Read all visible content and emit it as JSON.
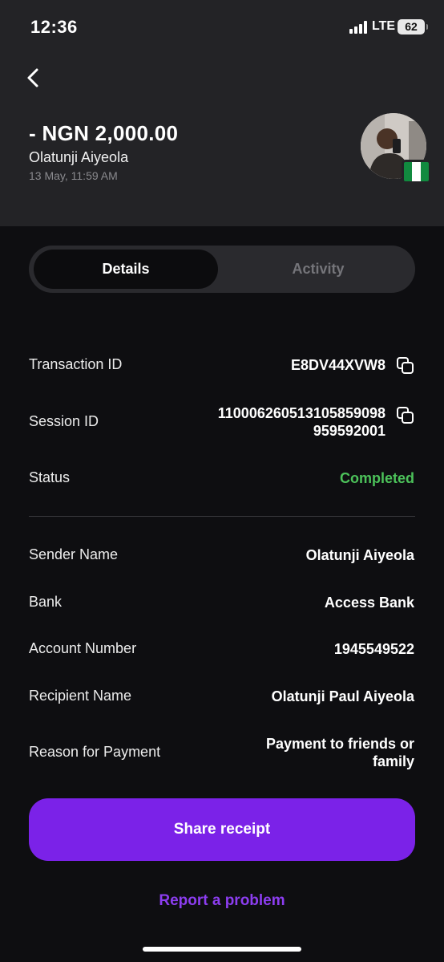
{
  "status_bar": {
    "time": "12:36",
    "network": "LTE",
    "battery": "62"
  },
  "transaction": {
    "amount": "- NGN 2,000.00",
    "name": "Olatunji Aiyeola",
    "datetime": "13 May, 11:59 AM"
  },
  "tabs": [
    {
      "label": "Details",
      "active": true
    },
    {
      "label": "Activity",
      "active": false
    }
  ],
  "details": {
    "transaction_id": {
      "label": "Transaction ID",
      "value": "E8DV44XVW8"
    },
    "session_id": {
      "label": "Session ID",
      "value_line1": "110006260513105859098",
      "value_line2": "959592001"
    },
    "status": {
      "label": "Status",
      "value": "Completed",
      "color": "#4cc25a"
    },
    "sender_name": {
      "label": "Sender Name",
      "value": "Olatunji Aiyeola"
    },
    "bank": {
      "label": "Bank",
      "value": "Access Bank"
    },
    "account_number": {
      "label": "Account Number",
      "value": "1945549522"
    },
    "recipient_name": {
      "label": "Recipient Name",
      "value": "Olatunji Paul Aiyeola"
    },
    "reason": {
      "label": "Reason for Payment",
      "value_line1": "Payment to friends or",
      "value_line2": "family"
    }
  },
  "actions": {
    "share_label": "Share receipt",
    "report_label": "Report a problem"
  },
  "colors": {
    "accent": "#7b22e8",
    "link": "#8c3df0",
    "header_bg": "#232326",
    "background": "#0e0e11"
  },
  "icons": [
    "back-chevron-icon",
    "copy-icon",
    "signal-icon",
    "battery-icon",
    "nigeria-flag-icon"
  ]
}
